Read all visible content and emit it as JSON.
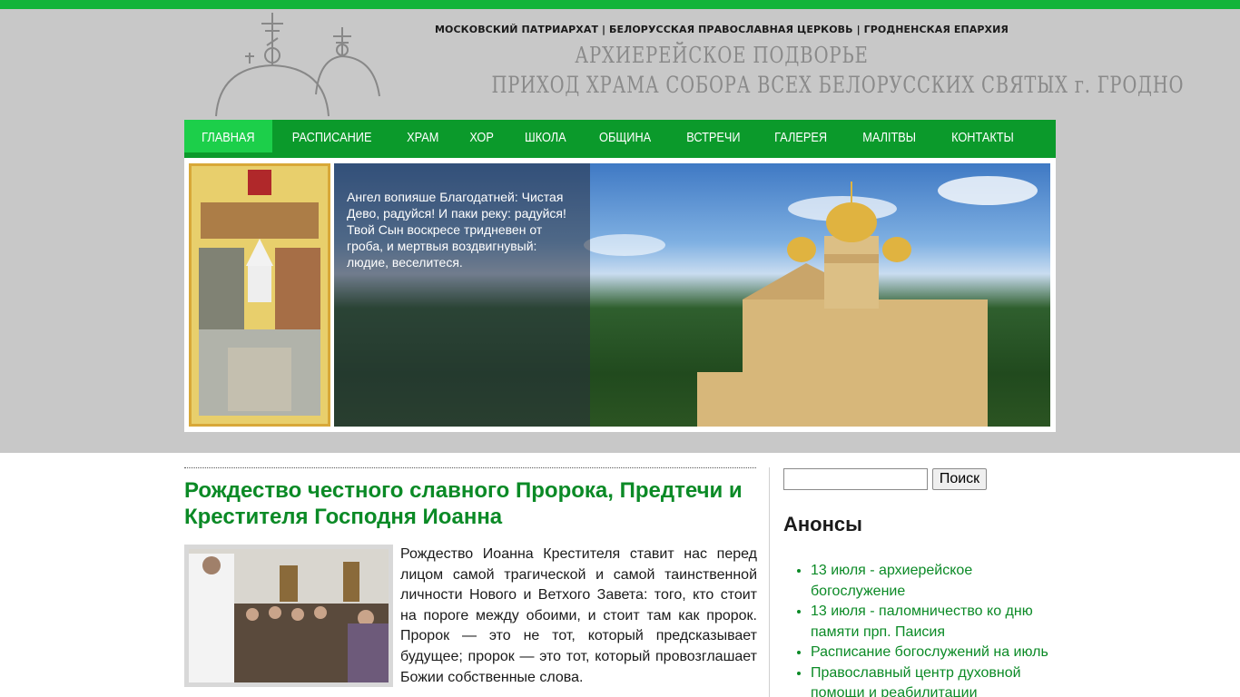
{
  "header": {
    "supertitle": "МОСКОВСКИЙ ПАТРИАРХАТ | БЕЛОРУССКАЯ ПРАВОСЛАВНАЯ ЦЕРКОВЬ | ГРОДНЕНСКАЯ ЕПАРХИЯ",
    "title1": "АРХИЕРЕЙСКОЕ ПОДВОРЬЕ",
    "title2": "ПРИХОД ХРАМА СОБОРА ВСЕХ БЕЛОРУССКИХ СВЯТЫХ г. ГРОДНО"
  },
  "nav": {
    "items": [
      {
        "label": "ГЛАВНАЯ",
        "active": true
      },
      {
        "label": "РАСПИСАНИЕ"
      },
      {
        "label": "ХРАМ"
      },
      {
        "label": "ХОР"
      },
      {
        "label": "ШКОЛА"
      },
      {
        "label": "ОБЩИНА"
      },
      {
        "label": "ВСТРЕЧИ"
      },
      {
        "label": "ГАЛЕРЕЯ"
      },
      {
        "label": "МАЛІТВЫ"
      },
      {
        "label": "КОНТАКТЫ"
      }
    ]
  },
  "slider": {
    "caption": "Ангел вопияше Благодатней: Чистая Дево, радуйся! И паки реку: радуйся! Твой Сын воскресе тридневен от гроба, и мертвыя воздвигнувый: людие, веселитеся."
  },
  "post": {
    "title": "Рождество честного славного Пророка, Предтечи и Крестителя Господня Иоанна",
    "excerpt": "Рождество Иоанна Крестителя ставит нас перед лицом самой трагической и самой таинственной личности Нового и Ветхого Завета: того, кто стоит на пороге между обоими, и стоит там как пророк. Пророк — это не тот, который предсказывает будущее; пророк — это тот, который провозглашает Божии собственные слова."
  },
  "sidebar": {
    "search_button": "Поиск",
    "search_value": "",
    "widget_title": "Анонсы",
    "anons": [
      "13 июля - архиерейское богослужение",
      "13 июля - паломничество ко дню памяти прп. Паисия",
      "Расписание богослужений на июль",
      "Православный центр духовной помощи и реабилитации"
    ]
  },
  "colors": {
    "brand_green": "#0b9a2b",
    "active_green": "#1ccf4a",
    "link_green": "#0b8a26",
    "header_gray": "#c8c8c8"
  }
}
